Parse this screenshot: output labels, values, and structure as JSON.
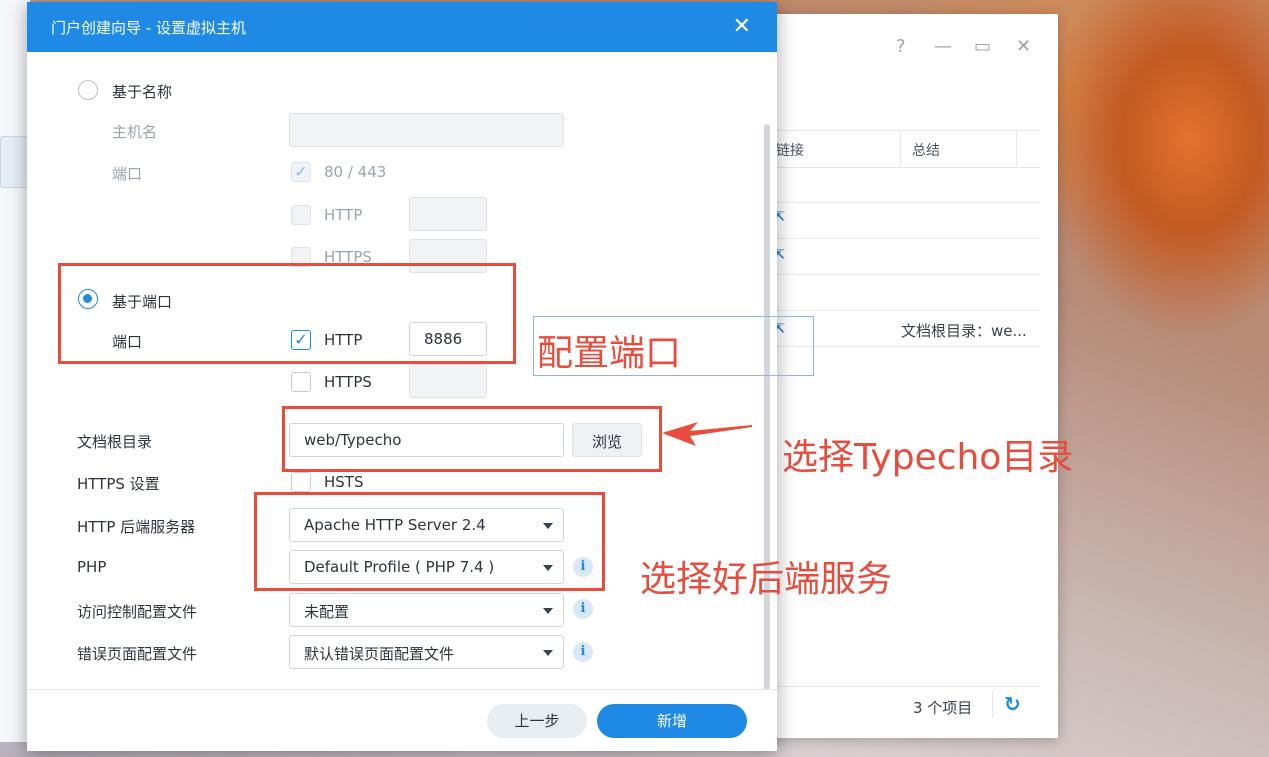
{
  "dialog": {
    "title": "门户创建向导 - 设置虚拟主机",
    "close": "✕",
    "name_section": {
      "radio_label": "基于名称",
      "hostname_label": "主机名",
      "port_label": "端口",
      "default_ports": "80 / 443",
      "http": "HTTP",
      "https": "HTTPS"
    },
    "port_section": {
      "radio_label": "基于端口",
      "port_label": "端口",
      "http": "HTTP",
      "http_port": "8886",
      "https": "HTTPS"
    },
    "docroot": {
      "label": "文档根目录",
      "value": "web/Typecho",
      "browse": "浏览"
    },
    "https_settings": {
      "label": "HTTPS 设置",
      "hsts": "HSTS"
    },
    "backend": {
      "label": "HTTP 后端服务器",
      "value": "Apache HTTP Server 2.4"
    },
    "php": {
      "label": "PHP",
      "value": "Default Profile ( PHP 7.4 )"
    },
    "access_control": {
      "label": "访问控制配置文件",
      "value": "未配置"
    },
    "error_page": {
      "label": "错误页面配置文件",
      "value": "默认错误页面配置文件"
    },
    "info_icon": "i",
    "buttons": {
      "back": "上一步",
      "add": "新增"
    }
  },
  "background_window": {
    "col_link": "链接",
    "col_summary": "总结",
    "row_summary": "文档根目录：we...",
    "item_count": "3 个项目",
    "help": "?",
    "minimize": "—",
    "maximize": "▭",
    "close": "✕",
    "refresh": "↻"
  },
  "annotations": {
    "port": "配置端口",
    "typecho": "选择Typecho目录",
    "backend": "选择好后端服务"
  },
  "colors": {
    "accent": "#1e8ae6",
    "annotation_red": "#e74c3c"
  }
}
